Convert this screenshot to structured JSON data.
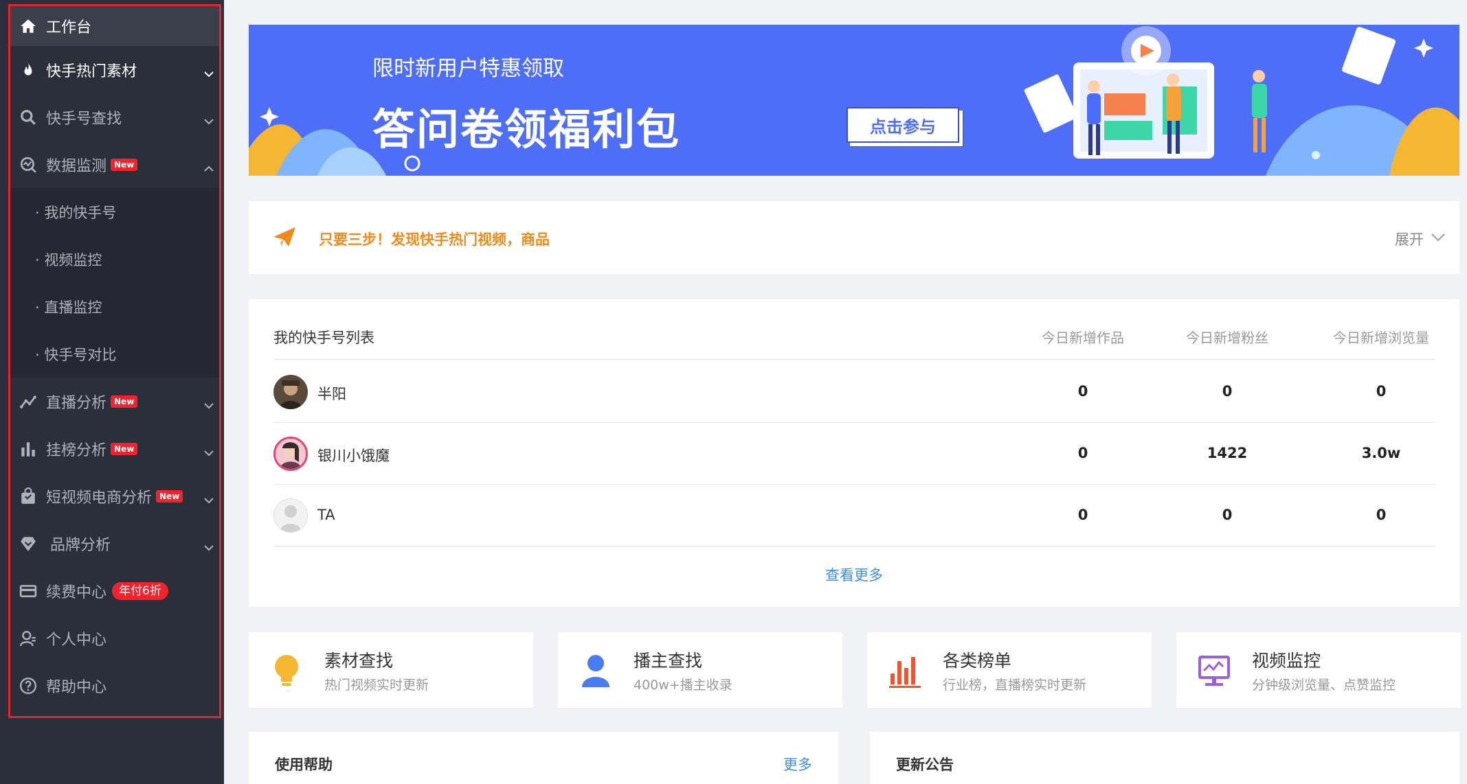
{
  "sidebar": {
    "items": [
      {
        "label": "工作台",
        "icon": "home-icon"
      },
      {
        "label": "快手热门素材",
        "icon": "fire-icon"
      },
      {
        "label": "快手号查找",
        "icon": "search-icon"
      },
      {
        "label": "数据监测",
        "icon": "monitor-icon",
        "badge": "New"
      },
      {
        "label": "直播分析",
        "icon": "trend-icon",
        "badge": "New"
      },
      {
        "label": "挂榜分析",
        "icon": "bar-icon",
        "badge": "New"
      },
      {
        "label": "短视频电商分析",
        "icon": "bag-icon",
        "badge": "New"
      },
      {
        "label": "品牌分析",
        "icon": "diamond-icon"
      },
      {
        "label": "续费中心",
        "icon": "card-icon",
        "badge": "年付6折"
      },
      {
        "label": "个人中心",
        "icon": "user-icon"
      },
      {
        "label": "帮助中心",
        "icon": "help-icon"
      }
    ],
    "submenu": [
      "· 我的快手号",
      "· 视频监控",
      "· 直播监控",
      "· 快手号对比"
    ]
  },
  "banner": {
    "subtitle": "限时新用户特惠领取",
    "title": "答问卷领福利包",
    "button": "点击参与"
  },
  "steps": {
    "text": "只要三步！发现快手热门视频，商品",
    "expand": "展开"
  },
  "accounts": {
    "title": "我的快手号列表",
    "columns": [
      "今日新增作品",
      "今日新增粉丝",
      "今日新增浏览量"
    ],
    "rows": [
      {
        "name": "半阳",
        "works": "0",
        "fans": "0",
        "views": "0"
      },
      {
        "name": "银川小饿魔",
        "works": "0",
        "fans": "1422",
        "views": "3.0w"
      },
      {
        "name": "TA",
        "works": "0",
        "fans": "0",
        "views": "0"
      }
    ],
    "more": "查看更多"
  },
  "features": [
    {
      "title": "素材查找",
      "desc": "热门视频实时更新",
      "icon": "bulb-icon",
      "color": "#f5b731"
    },
    {
      "title": "播主查找",
      "desc": "400w+播主收录",
      "icon": "person-icon",
      "color": "#4a7cf0"
    },
    {
      "title": "各类榜单",
      "desc": "行业榜，直播榜实时更新",
      "icon": "chart-icon",
      "color": "#f0552e"
    },
    {
      "title": "视频监控",
      "desc": "分钟级浏览量、点赞监控",
      "icon": "screen-icon",
      "color": "#9b5de5"
    }
  ],
  "bottom": {
    "help_title": "使用帮助",
    "help_more": "更多",
    "notice_title": "更新公告"
  }
}
